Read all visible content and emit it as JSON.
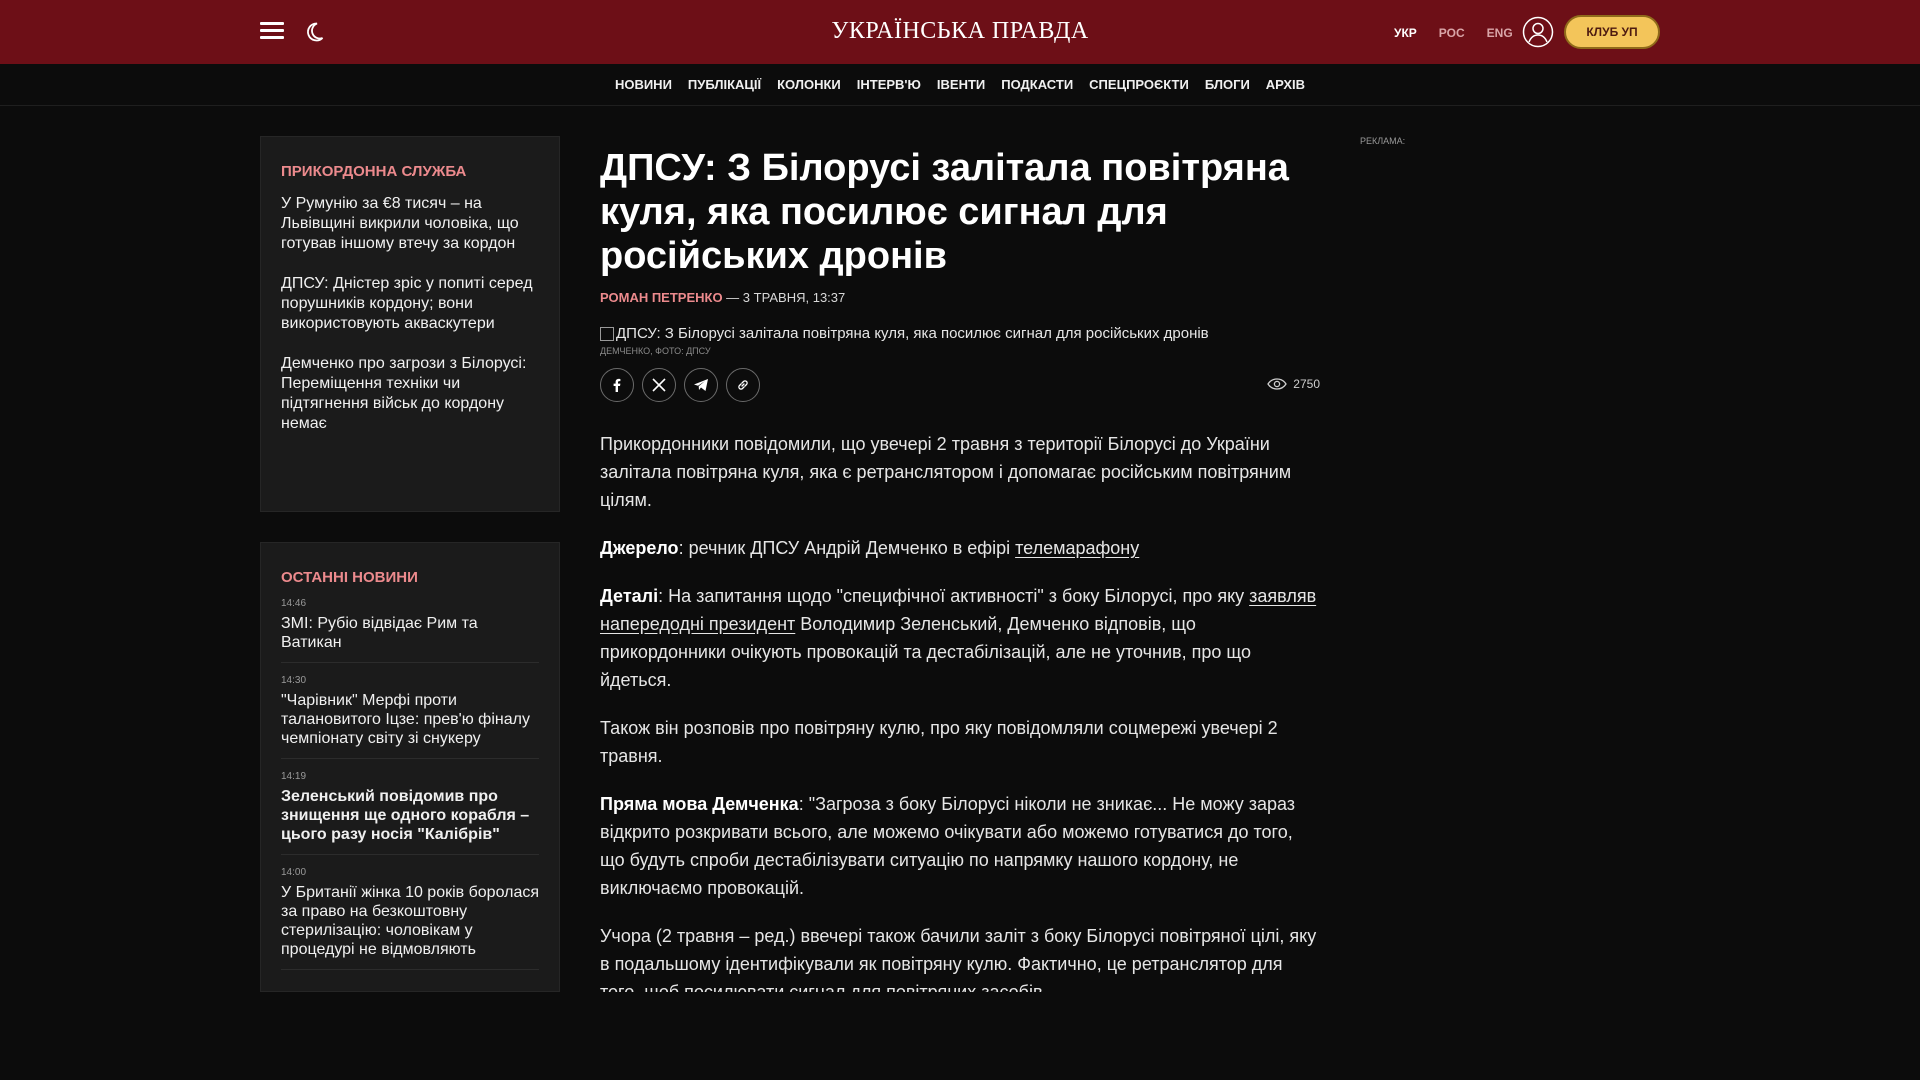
{
  "header": {
    "logo": "УКРАЇНСЬКА ПРАВДА",
    "langs": [
      "УКР",
      "РОС",
      "ENG"
    ],
    "club_button": "КЛУБ УП"
  },
  "nav": [
    "НОВИНИ",
    "ПУБЛІКАЦІЇ",
    "КОЛОНКИ",
    "ІНТЕРВ'Ю",
    "ІВЕНТИ",
    "ПОДКАСТИ",
    "СПЕЦПРОЄКТИ",
    "БЛОГИ",
    "АРХІВ"
  ],
  "sidebar_topic": {
    "title": "ПРИКОРДОННА СЛУЖБА",
    "items": [
      "У Румунію за €8 тисяч – на Львівщині викрили чоловіка, що готував іншому втечу за кордон",
      "ДПСУ: Дністер зріс у попиті серед порушників кордону; вони використовують аквaскутери",
      "Демченко про загрози з Білорусі: Переміщення техніки чи підтягнення військ до кордону немає"
    ]
  },
  "latest_news": {
    "title": "ОСТАННІ НОВИНИ",
    "items": [
      {
        "time": "14:46",
        "title": "ЗМІ: Рубіо відвідає Рим та Ватикан",
        "bold": false
      },
      {
        "time": "14:30",
        "title": "\"Чарівник\" Мерфі проти талановитого Іцзе: прев'ю фіналу чемпіонату світу зі снукеру",
        "bold": false
      },
      {
        "time": "14:19",
        "title": "Зеленський повідомив про знищення ще одного корабля – цього разу носія \"Калібрів\"",
        "bold": true
      },
      {
        "time": "14:00",
        "title": "У Британії жінка 10 років боролася за право на безкоштовну стерилізацію: чоловікам у процедурі не відмовляють",
        "bold": false
      }
    ]
  },
  "article": {
    "headline": "ДПСУ: З Білорусі залітала повітряна куля, яка посилює сигнал для російських дронів",
    "author": "РОМАН ПЕТРЕНКО",
    "date": " — 3 ТРАВНЯ, 13:37",
    "photo_alt": "ДПСУ: З Білорусі залітала повітряна куля, яка посилює сигнал для російських дронів",
    "photo_caption": "ДЕМЧЕНКО, ФОТО: ДПСУ",
    "views": "2750",
    "p1": "Прикордонники повідомили, що увечері 2 травня з території Білорусі до України залітала повітряна куля, яка є ретранслятором і допомагає російським повітряним цілям.",
    "p2_label": "Джерело",
    "p2_text": ": речник ДПСУ Андрій Демченко в ефірі ",
    "p2_link": "телемарафону",
    "p3_label": "Деталі",
    "p3_text1": ": На запитання щодо \"специфічної активності\" з боку Білорусі, про яку ",
    "p3_link": "заявляв напередодні президент",
    "p3_text2": " Володимир Зеленський, Демченко відповів, що прикордонники очікують провокацій та дестабілізацій, але не уточнив, про що йдеться.",
    "p4": "Також він розповів про повітряну кулю, про яку повідомляли соцмережі увечері 2 травня.",
    "p5_label": "Пряма мова Демченка",
    "p5_text": ": \"Загроза з боку Білорусі ніколи не зникає... Не можу зараз відкрито розкривати всього, але можемо очікувати або можемо готуватися до того, що будуть спроби дестабілізувати ситуацію по напрямку нашого кордону, не виключаємо провокацій.",
    "p6": "Учора (2 травня – ред.) ввечері також бачили заліт з боку Білорусі повітряної цілі, яку в подальшому ідентифікували як повітряну кулю. Фактично, це ретранслятор для того, щоб посилювати сигнал для повітряних засобів"
  },
  "ad_label": "РЕКЛАМА:",
  "colors": {
    "topbar": "#6d0f17",
    "accent": "#ec8a8d",
    "club": "#f3c55a",
    "background": "#0c0c0c"
  }
}
